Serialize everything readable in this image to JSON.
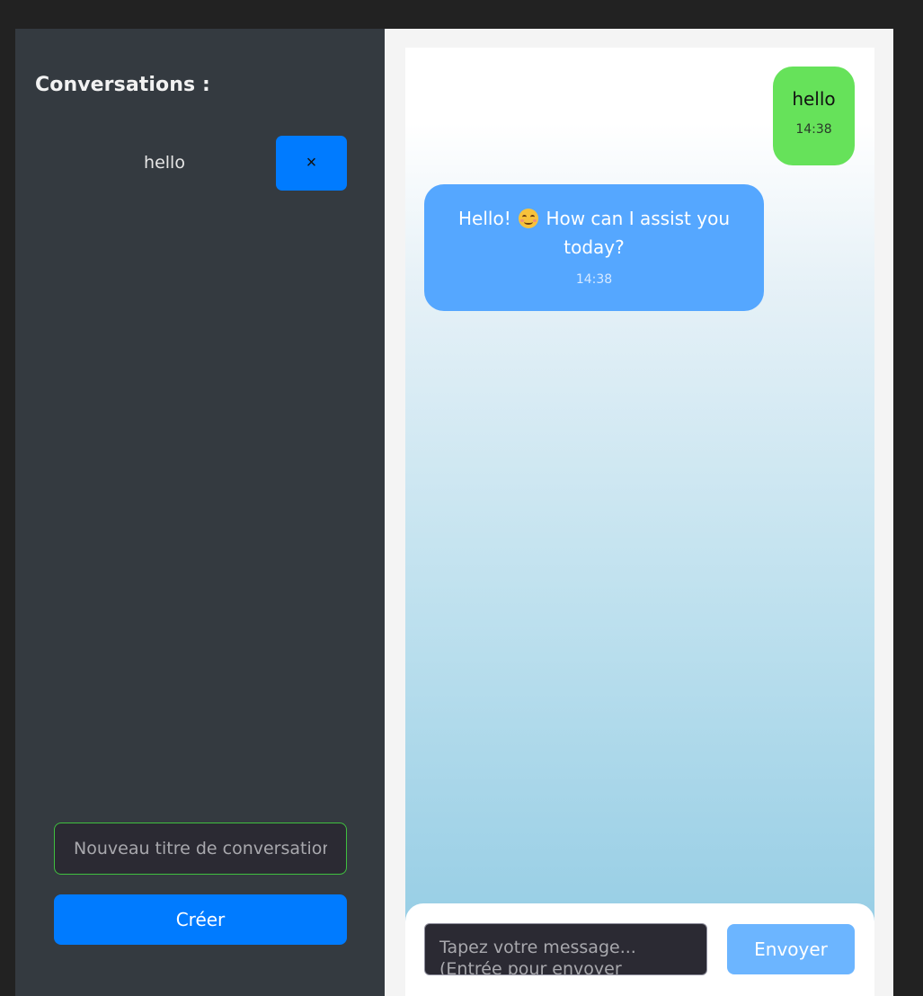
{
  "sidebar": {
    "title": "Conversations :",
    "conversations": [
      {
        "title": "hello",
        "delete_label": "×"
      }
    ],
    "new_conversation_placeholder": "Nouveau titre de conversation",
    "create_label": "Créer"
  },
  "chat": {
    "messages": [
      {
        "role": "user",
        "text": "hello",
        "time": "14:38"
      },
      {
        "role": "assistant",
        "text_before": "Hello!",
        "emoji": "smiling-face-emoji",
        "text_after": "How can I assist you today?",
        "time": "14:38"
      }
    ],
    "composer": {
      "placeholder": "Tapez votre message... (Entrée pour envoyer",
      "send_label": "Envoyer"
    }
  },
  "colors": {
    "sidebar_bg": "#343a40",
    "primary": "#007bff",
    "user_bubble": "#66e25a",
    "assistant_bubble": "#55a7ff",
    "send_button": "#6cb5ff"
  }
}
